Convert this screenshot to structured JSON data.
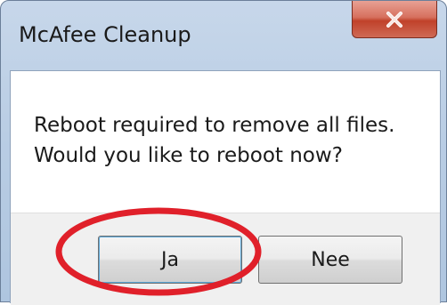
{
  "window": {
    "title": "McAfee Cleanup"
  },
  "message": {
    "line1": "Reboot required to remove all files.",
    "line2": "Would you like to reboot now?"
  },
  "buttons": {
    "yes_label": "Ja",
    "no_label": "Nee"
  },
  "icons": {
    "close": "close-icon"
  },
  "colors": {
    "close_button": "#c7442e",
    "annotation_circle": "#e0202a",
    "titlebar": "#b9cde4"
  }
}
